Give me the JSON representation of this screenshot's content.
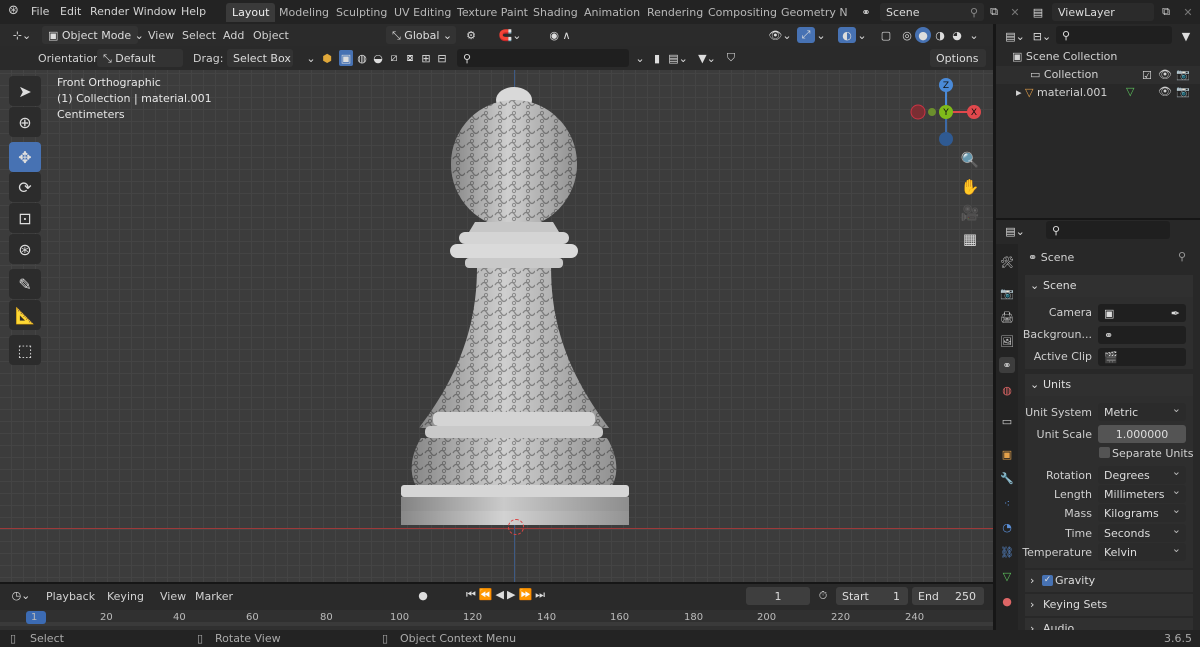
{
  "app": {
    "version": "3.6.5"
  },
  "menubar": {
    "items": [
      "File",
      "Edit",
      "Render",
      "Window",
      "Help"
    ]
  },
  "workspaces": [
    "Layout",
    "Modeling",
    "Sculpting",
    "UV Editing",
    "Texture Paint",
    "Shading",
    "Animation",
    "Rendering",
    "Compositing",
    "Geometry Noc"
  ],
  "scene_field": "Scene",
  "viewlayer_field": "ViewLayer",
  "header": {
    "mode": "Object Mode",
    "menus": [
      "View",
      "Select",
      "Add",
      "Object"
    ],
    "transform": "Global"
  },
  "toolsettings": {
    "orientation_label": "Orientation:",
    "orientation": "Default",
    "drag_label": "Drag:",
    "drag": "Select Box",
    "options": "Options"
  },
  "viewport": {
    "view_name": "Front Orthographic",
    "collection_info": "(1) Collection | material.001",
    "units": "Centimeters"
  },
  "gizmo": {
    "z": "Z",
    "y": "Y",
    "x": "X"
  },
  "outliner": {
    "root": "Scene Collection",
    "collection": "Collection",
    "object": "material.001"
  },
  "properties": {
    "context": "Scene",
    "scene_section": "Scene",
    "camera_label": "Camera",
    "background_label": "Backgroun...",
    "clip_label": "Active Clip",
    "units_section": "Units",
    "unit_system_label": "Unit System",
    "unit_system": "Metric",
    "unit_scale_label": "Unit Scale",
    "unit_scale": "1.000000",
    "separate_units": "Separate Units",
    "rotation_label": "Rotation",
    "rotation": "Degrees",
    "length_label": "Length",
    "length": "Millimeters",
    "mass_label": "Mass",
    "mass": "Kilograms",
    "time_label": "Time",
    "time": "Seconds",
    "temperature_label": "Temperature",
    "temperature": "Kelvin",
    "gravity": "Gravity",
    "keying_sets": "Keying Sets",
    "audio": "Audio"
  },
  "timeline": {
    "menus": [
      "Playback",
      "Keying",
      "View",
      "Marker"
    ],
    "current_frame": "1",
    "start_label": "Start",
    "start": "1",
    "end_label": "End",
    "end": "250",
    "ticks": [
      "1",
      "20",
      "40",
      "60",
      "80",
      "100",
      "120",
      "140",
      "160",
      "180",
      "200",
      "220",
      "240"
    ]
  },
  "statusbar": {
    "select": "Select",
    "rotate": "Rotate View",
    "context": "Object Context Menu"
  },
  "colors": {
    "accent": "#4772b3",
    "x_axis": "#e0484c",
    "y_axis": "#7fba1a",
    "z_axis": "#4a8ad8",
    "frame": "#3c6bb3"
  }
}
